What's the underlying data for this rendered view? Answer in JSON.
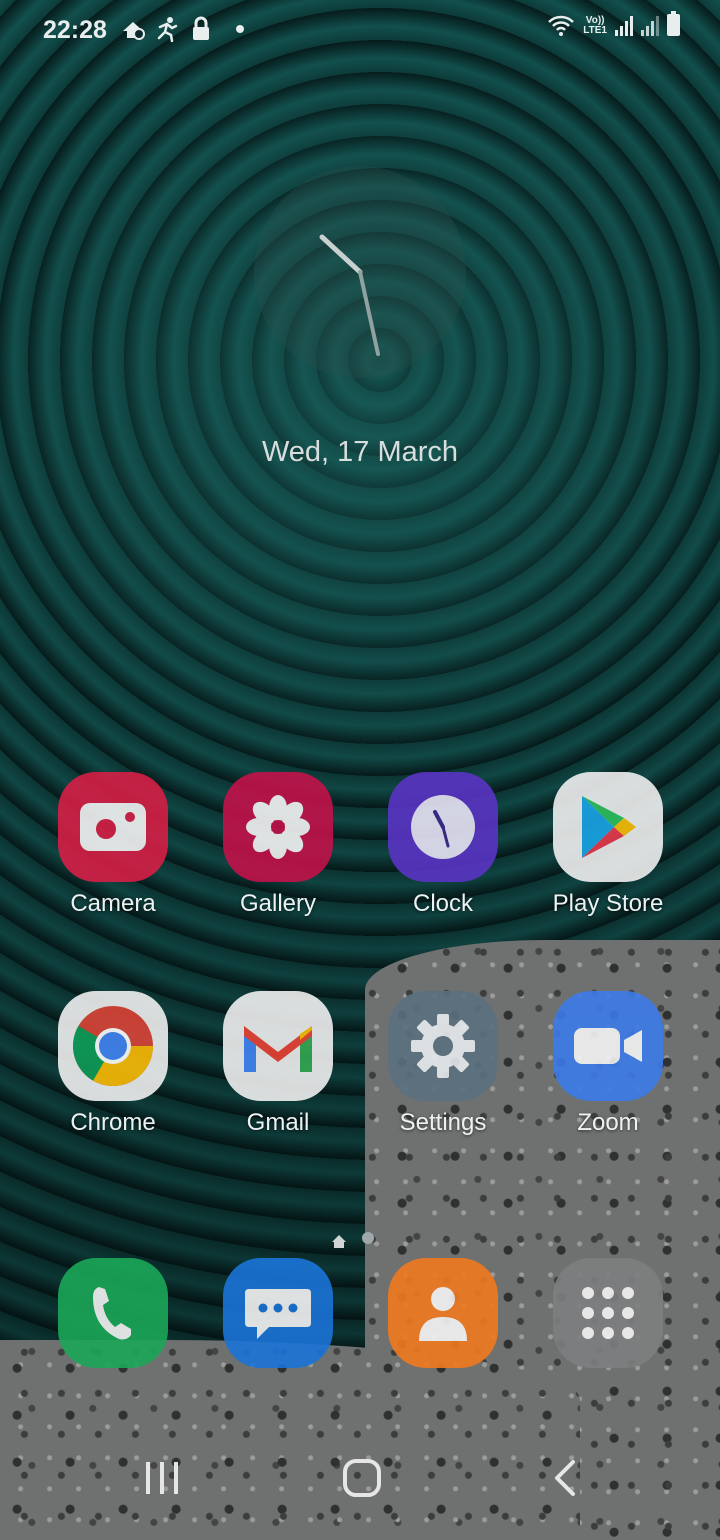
{
  "status_bar": {
    "time": "22:28",
    "left_icons": [
      "notification-icon",
      "runner-icon",
      "lock-icon"
    ],
    "volte_label": "Vo))",
    "lte_label": "LTE1",
    "right_icons": [
      "wifi-icon",
      "signal-icon",
      "signal-icon",
      "battery-icon"
    ]
  },
  "clock_widget": {
    "hour_hand": "22:28"
  },
  "date": "Wed, 17 March",
  "apps": [
    {
      "label": "Camera",
      "icon": "camera-icon",
      "color": "#d61f46"
    },
    {
      "label": "Gallery",
      "icon": "gallery-flower-icon",
      "color": "#c2124a"
    },
    {
      "label": "Clock",
      "icon": "clock-icon",
      "color": "#5a34c4"
    },
    {
      "label": "Play Store",
      "icon": "play-store-icon",
      "color": "#f1f1f1"
    },
    {
      "label": "Chrome",
      "icon": "chrome-icon",
      "color": "#f1f1f1"
    },
    {
      "label": "Gmail",
      "icon": "gmail-icon",
      "color": "#f1f1f1"
    },
    {
      "label": "Settings",
      "icon": "gear-icon",
      "color": "#5a7080"
    },
    {
      "label": "Zoom",
      "icon": "video-camera-icon",
      "color": "#3c7be8"
    }
  ],
  "dock": [
    {
      "name": "phone",
      "icon": "phone-icon",
      "color": "#1ba758"
    },
    {
      "name": "messages",
      "icon": "message-icon",
      "color": "#1b74d8"
    },
    {
      "name": "contacts",
      "icon": "contacts-icon",
      "color": "#f07a1f"
    },
    {
      "name": "apps",
      "icon": "app-drawer-icon",
      "color": "#7d7f80"
    }
  ],
  "nav": [
    "recents-icon",
    "home-icon",
    "back-icon"
  ]
}
